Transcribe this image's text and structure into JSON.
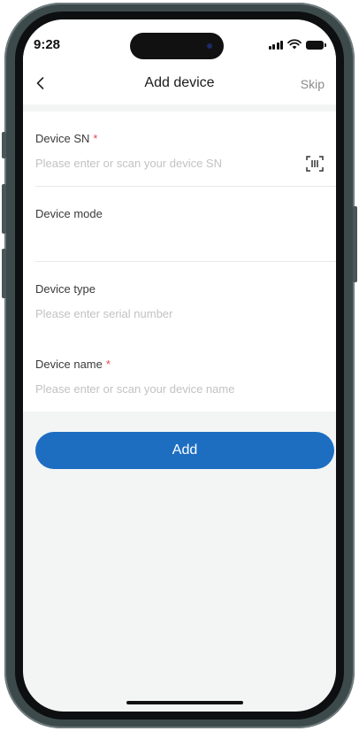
{
  "status_bar": {
    "time": "9:28"
  },
  "header": {
    "title": "Add device",
    "skip_label": "Skip"
  },
  "form": {
    "required_mark": "*",
    "device_sn": {
      "label": "Device SN",
      "required": true,
      "placeholder": "Please enter or scan your device SN",
      "value": ""
    },
    "device_mode": {
      "label": "Device mode",
      "value": ""
    },
    "device_type": {
      "label": "Device type",
      "placeholder": "Please enter serial number",
      "value": ""
    },
    "device_name": {
      "label": "Device name",
      "required": true,
      "placeholder": "Please enter or scan your device name",
      "value": ""
    }
  },
  "actions": {
    "add_label": "Add"
  },
  "icons": {
    "back": "chevron-left-icon",
    "scan": "scan-icon",
    "signal": "cellular-signal-icon",
    "wifi": "wifi-icon",
    "battery": "battery-icon"
  },
  "colors": {
    "primary": "#1d6ec1",
    "required": "#e5484d",
    "placeholder": "#c2c2c2",
    "background": "#f3f5f5"
  }
}
